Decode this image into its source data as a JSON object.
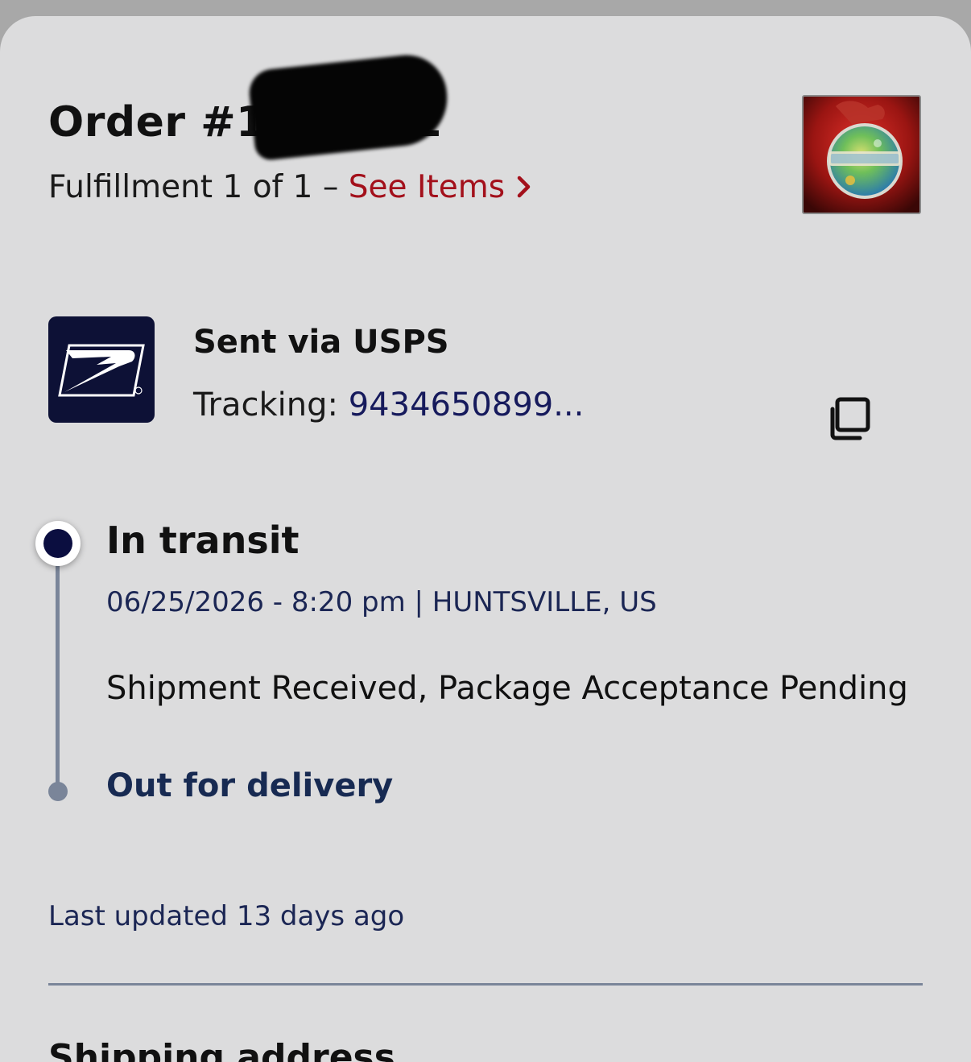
{
  "order": {
    "title": "Order #1377632",
    "fulfillment_prefix": "Fulfillment 1 of 1 – ",
    "see_items_label": "See Items"
  },
  "product": {
    "thumbnail_icon": "product-thumbnail"
  },
  "shipment": {
    "carrier_label": "Sent via USPS",
    "tracking_prefix": "Tracking: ",
    "tracking_number": "9434650899..."
  },
  "timeline": {
    "current": {
      "status": "In transit",
      "meta": "06/25/2026 - 8:20 pm | HUNTSVILLE, US",
      "description": "Shipment Received, Package Acceptance Pending"
    },
    "next": {
      "status": "Out for delivery"
    }
  },
  "footer": {
    "last_updated": "Last updated 13 days ago",
    "section_title": "Shipping address"
  },
  "colors": {
    "background": "#dcdcdd",
    "accent_link": "#a3101b",
    "usps_navy": "#0d1136",
    "timeline_gray": "#7a8599",
    "meta_text": "#1b2654"
  }
}
